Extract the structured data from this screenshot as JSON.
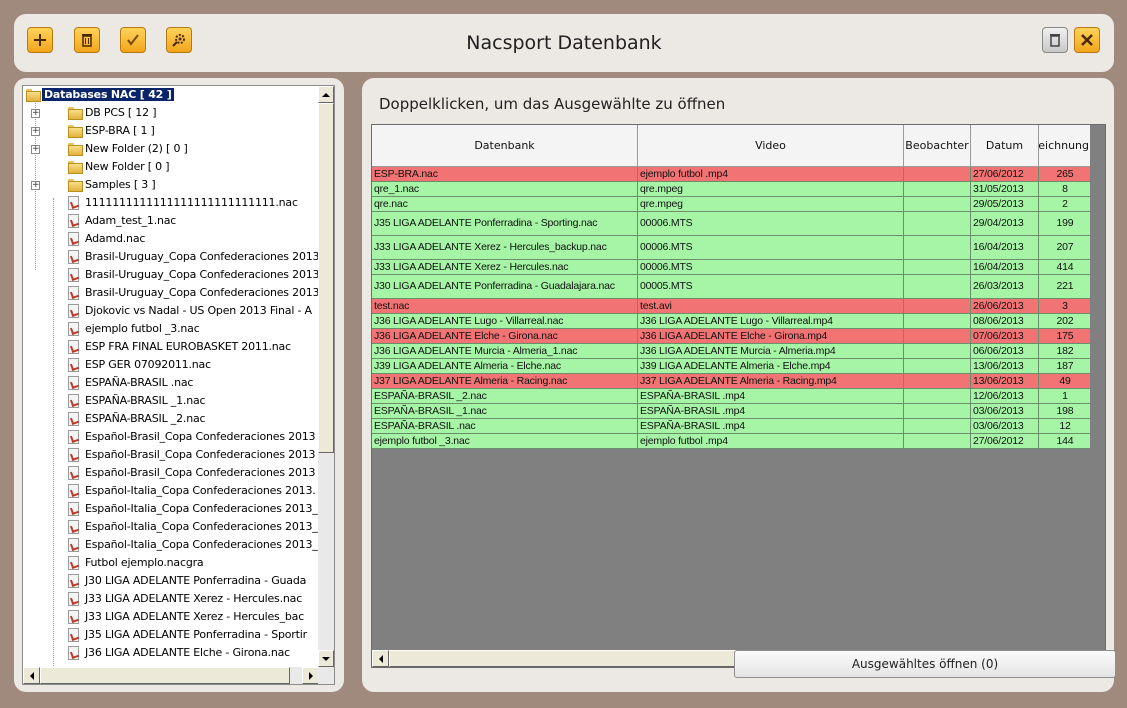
{
  "app": {
    "title": "Nacsport Datenbank"
  },
  "toolbar": {
    "left_icons": [
      "plus-icon",
      "trash-icon",
      "checkmark-icon",
      "gear-wrench-icon"
    ],
    "right_icons": [
      "database-icon",
      "close-icon"
    ]
  },
  "tree": {
    "root_label": "Databases NAC [ 42 ]",
    "folders": [
      {
        "label": "DB PCS [ 12 ]",
        "expandable": true
      },
      {
        "label": "ESP-BRA [ 1 ]",
        "expandable": true
      },
      {
        "label": "New Folder (2) [ 0 ]",
        "expandable": true
      },
      {
        "label": "New Folder [ 0 ]",
        "expandable": false
      },
      {
        "label": "Samples [ 3 ]",
        "expandable": true
      }
    ],
    "files": [
      "1111111111111111111111111111.nac",
      "Adam_test_1.nac",
      "Adamd.nac",
      "Brasil-Uruguay_Copa Confederaciones 2013",
      "Brasil-Uruguay_Copa Confederaciones 2013",
      "Brasil-Uruguay_Copa Confederaciones 2013",
      "Djokovic vs Nadal - US Open 2013 Final - A",
      "ejemplo futbol _3.nac",
      "ESP FRA FINAL EUROBASKET 2011.nac",
      "ESP GER 07092011.nac",
      "ESPAÑA-BRASIL .nac",
      "ESPAÑA-BRASIL _1.nac",
      "ESPAÑA-BRASIL _2.nac",
      "Español-Brasil_Copa Confederaciones 2013",
      "Español-Brasil_Copa Confederaciones 2013",
      "Español-Brasil_Copa Confederaciones 2013",
      "Español-Italia_Copa Confederaciones 2013.",
      "Español-Italia_Copa Confederaciones 2013_",
      "Español-Italia_Copa Confederaciones 2013_",
      "Español-Italia_Copa Confederaciones 2013_",
      "Futbol ejemplo.nacgra",
      "J30 LIGA ADELANTE Ponferradina - Guada",
      "J33 LIGA ADELANTE Xerez - Hercules.nac",
      "J33 LIGA ADELANTE Xerez - Hercules_bac",
      "J35 LIGA ADELANTE Ponferradina - Sportir",
      "J36 LIGA ADELANTE Elche - Girona.nac"
    ]
  },
  "main": {
    "hint": "Doppelklicken, um das Ausgewählte zu öffnen",
    "columns": [
      "Datenbank",
      "Video",
      "Beobachter",
      "Datum",
      "zeichnung"
    ],
    "rows": [
      {
        "db": "ESP-BRA.nac",
        "video": "ejemplo futbol .mp4",
        "obs": "",
        "date": "27/06/2012",
        "count": "265",
        "status": "red"
      },
      {
        "db": "qre_1.nac",
        "video": "qre.mpeg",
        "obs": "",
        "date": "31/05/2013",
        "count": "8",
        "status": "green"
      },
      {
        "db": "qre.nac",
        "video": "qre.mpeg",
        "obs": "",
        "date": "29/05/2013",
        "count": "2",
        "status": "green"
      },
      {
        "db": "J35 LIGA ADELANTE Ponferradina - Sporting.nac",
        "video": "00006.MTS",
        "obs": "",
        "date": "29/04/2013",
        "count": "199",
        "status": "green"
      },
      {
        "db": "J33 LIGA ADELANTE Xerez - Hercules_backup.nac",
        "video": "00006.MTS",
        "obs": "",
        "date": "16/04/2013",
        "count": "207",
        "status": "green"
      },
      {
        "db": "J33 LIGA ADELANTE Xerez - Hercules.nac",
        "video": "00006.MTS",
        "obs": "",
        "date": "16/04/2013",
        "count": "414",
        "status": "green"
      },
      {
        "db": "J30 LIGA ADELANTE Ponferradina - Guadalajara.nac",
        "video": "00005.MTS",
        "obs": "",
        "date": "26/03/2013",
        "count": "221",
        "status": "green"
      },
      {
        "db": "test.nac",
        "video": "test.avi",
        "obs": "",
        "date": "26/06/2013",
        "count": "3",
        "status": "red"
      },
      {
        "db": "J36 LIGA ADELANTE Lugo - Villarreal.nac",
        "video": "J36 LIGA ADELANTE Lugo - Villarreal.mp4",
        "obs": "",
        "date": "08/06/2013",
        "count": "202",
        "status": "green"
      },
      {
        "db": "J36 LIGA ADELANTE Elche - Girona.nac",
        "video": "J36 LIGA ADELANTE Elche - Girona.mp4",
        "obs": "",
        "date": "07/06/2013",
        "count": "175",
        "status": "red"
      },
      {
        "db": "J36 LIGA ADELANTE Murcia - Almeria_1.nac",
        "video": "J36 LIGA ADELANTE Murcia - Almeria.mp4",
        "obs": "",
        "date": "06/06/2013",
        "count": "182",
        "status": "green"
      },
      {
        "db": "J39 LIGA ADELANTE Almeria - Elche.nac",
        "video": "J39 LIGA ADELANTE Almeria - Elche.mp4",
        "obs": "",
        "date": "13/06/2013",
        "count": "187",
        "status": "green"
      },
      {
        "db": "J37 LIGA ADELANTE Almeria - Racing.nac",
        "video": "J37 LIGA ADELANTE Almeria - Racing.mp4",
        "obs": "",
        "date": "13/06/2013",
        "count": "49",
        "status": "red"
      },
      {
        "db": "ESPAÑA-BRASIL _2.nac",
        "video": "ESPAÑA-BRASIL .mp4",
        "obs": "",
        "date": "12/06/2013",
        "count": "1",
        "status": "green"
      },
      {
        "db": "ESPAÑA-BRASIL _1.nac",
        "video": "ESPAÑA-BRASIL .mp4",
        "obs": "",
        "date": "03/06/2013",
        "count": "198",
        "status": "green"
      },
      {
        "db": "ESPAÑA-BRASIL .nac",
        "video": "ESPAÑA-BRASIL .mp4",
        "obs": "",
        "date": "03/06/2013",
        "count": "12",
        "status": "green"
      },
      {
        "db": "ejemplo futbol _3.nac",
        "video": "ejemplo futbol .mp4",
        "obs": "",
        "date": "27/06/2012",
        "count": "144",
        "status": "green"
      }
    ],
    "open_button": "Ausgewähltes öffnen (0)"
  },
  "colors": {
    "row_green": "#a6f5a6",
    "row_red": "#f27373",
    "selection": "#0a246a",
    "frame": "#a08a7e"
  }
}
